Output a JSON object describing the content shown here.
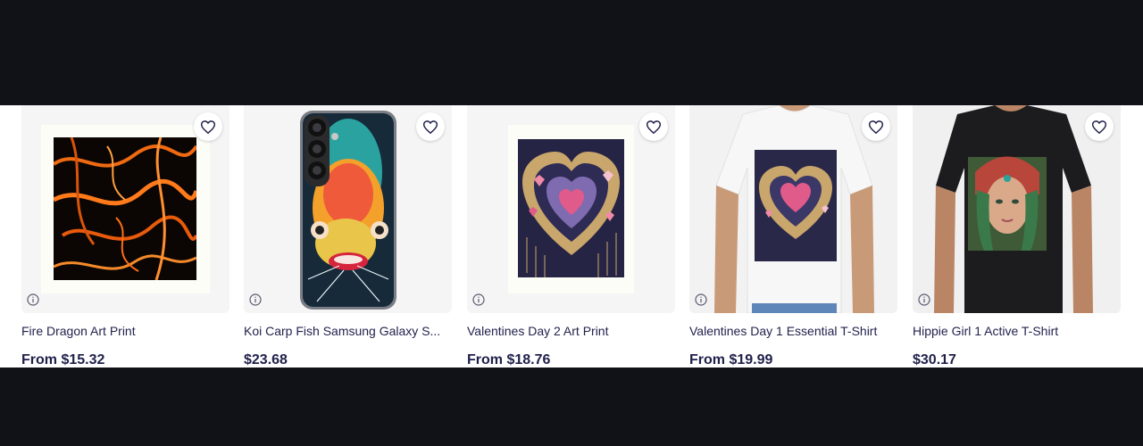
{
  "products": [
    {
      "title": "Fire Dragon Art Print",
      "price": "From $15.32"
    },
    {
      "title": "Koi Carp Fish Samsung Galaxy S...",
      "price": "$23.68"
    },
    {
      "title": "Valentines Day 2 Art Print",
      "price": "From $18.76"
    },
    {
      "title": "Valentines Day 1 Essential T-Shirt",
      "price": "From $19.99"
    },
    {
      "title": "Hippie Girl 1 Active T-Shirt",
      "price": "$30.17"
    }
  ],
  "icons": {
    "favorite": "heart-outline-icon",
    "info": "info-circle-icon"
  },
  "colors": {
    "page_background": "#111118",
    "title_text": "#23234f",
    "price_text": "#1f1f4a",
    "card_background": "#f5f5f6"
  }
}
